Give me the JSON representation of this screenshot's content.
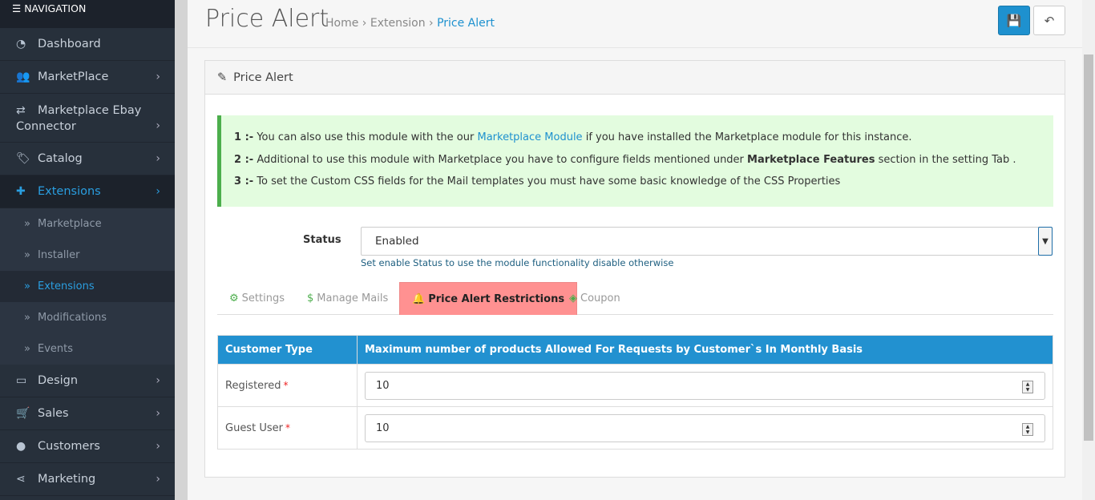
{
  "sidebar": {
    "header": "NAVIGATION",
    "items": [
      {
        "label": "Dashboard",
        "icon": "dashboard-icon"
      },
      {
        "label": "MarketPlace",
        "icon": "users-icon"
      },
      {
        "label": "Marketplace Ebay Connector",
        "icon": "retweet-icon"
      },
      {
        "label": "Catalog",
        "icon": "tags-icon"
      },
      {
        "label": "Extensions",
        "icon": "puzzle-icon"
      },
      {
        "label": "Design",
        "icon": "desktop-icon"
      },
      {
        "label": "Sales",
        "icon": "cart-icon"
      },
      {
        "label": "Customers",
        "icon": "user-icon"
      },
      {
        "label": "Marketing",
        "icon": "share-icon"
      }
    ],
    "sub_items": [
      "Marketplace",
      "Installer",
      "Extensions",
      "Modifications",
      "Events"
    ]
  },
  "header": {
    "title": "Price Alert",
    "breadcrumb": [
      "Home",
      "Extension",
      "Price Alert"
    ]
  },
  "panel": {
    "title": "Price Alert",
    "notes": [
      {
        "num": "1 :-",
        "pre": "You can also use this module with the our",
        "link": "Marketplace Module",
        "post": "if you have installed the Marketplace module for this instance."
      },
      {
        "num": "2 :-",
        "pre": "Additional to use this module with Marketplace you have to configure fields mentioned under",
        "bold": "Marketplace Features",
        "post": "section in the setting Tab ."
      },
      {
        "num": "3 :-",
        "pre": "To set the Custom CSS fields for the Mail templates you must have some basic knowledge of the CSS Properties"
      }
    ],
    "status_label": "Status",
    "status_value": "Enabled",
    "status_help": "Set enable Status to use the module functionality disable otherwise",
    "tabs": [
      "Settings",
      "Manage Mails",
      "Price Alert Restrictions",
      "Coupon"
    ],
    "table": {
      "headers": [
        "Customer Type",
        "Maximum number of products Allowed For Requests by Customer`s In Monthly Basis"
      ],
      "rows": [
        {
          "type": "Registered",
          "value": "10"
        },
        {
          "type": "Guest User",
          "value": "10"
        }
      ]
    }
  },
  "colors": {
    "accent": "#1e91cf",
    "active_tab": "#ff9191",
    "alert_bg": "#e3fcdf"
  }
}
